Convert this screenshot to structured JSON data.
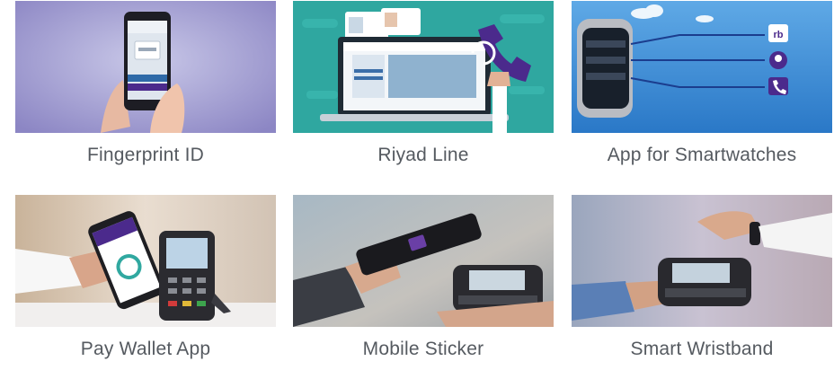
{
  "products": [
    {
      "caption": "Fingerprint ID",
      "image": "phone-fingerprint-photo"
    },
    {
      "caption": "Riyad Line",
      "image": "laptop-phone-support-illustration"
    },
    {
      "caption": "App for Smartwatches",
      "image": "smartwatch-app-illustration"
    },
    {
      "caption": "Pay Wallet App",
      "image": "phone-pos-payment-photo"
    },
    {
      "caption": "Mobile Sticker",
      "image": "mobile-sticker-pos-photo"
    },
    {
      "caption": "Smart Wristband",
      "image": "wristband-pos-payment-photo"
    }
  ],
  "smartwatch_icons": [
    {
      "name": "rb-icon",
      "label": "rb"
    },
    {
      "name": "location-pin-icon"
    },
    {
      "name": "phone-icon"
    }
  ],
  "colors": {
    "caption_text": "#555a60",
    "accent_purple": "#4b2a8c",
    "teal": "#2fa7a0",
    "sky": "#3b8fd6"
  }
}
